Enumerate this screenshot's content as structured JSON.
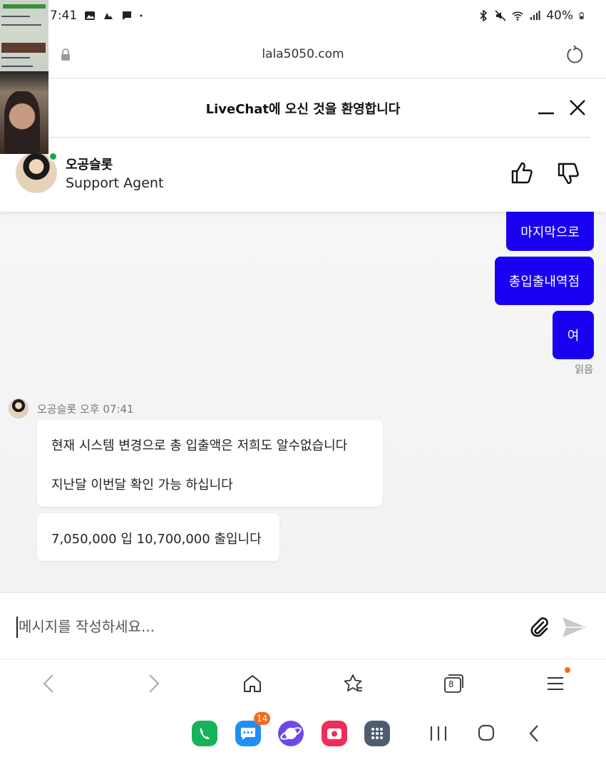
{
  "status_bar": {
    "time": "7:41",
    "battery": "40%"
  },
  "browser": {
    "url": "lala5050.com",
    "tab_count": "8"
  },
  "chat_header": {
    "welcome_text": "LiveChat에 오신 것을 환영합니다",
    "agent_name": "오공슬롯",
    "agent_role": "Support Agent"
  },
  "messages": {
    "outgoing": [
      {
        "text": "마지막으로"
      },
      {
        "text": "총입출내역점"
      },
      {
        "text": "여"
      }
    ],
    "read_status": "읽음",
    "incoming_meta": "오공슬롯 오후 07:41",
    "incoming": [
      {
        "line1": "현재 시스템 변경으로 총 입출액은 저희도 알수없습니다",
        "line2": "지난달 이번달 확인 가능 하십니다"
      },
      {
        "line1": "7,050,000 입 10,700,000 출입니다"
      }
    ]
  },
  "composer": {
    "placeholder": "메시지를 작성하세요..."
  },
  "dock": {
    "messages_badge": "14"
  },
  "icons": {
    "lock": "lock-icon",
    "reload": "reload-icon",
    "minimize": "minimize-icon",
    "close": "close-icon",
    "thumbs_up": "thumbs-up-icon",
    "thumbs_down": "thumbs-down-icon",
    "attach": "paperclip-icon",
    "send": "send-icon"
  },
  "colors": {
    "outgoing_bubble": "#1a00f0",
    "online": "#1da64a",
    "badge": "#f26a1b"
  }
}
